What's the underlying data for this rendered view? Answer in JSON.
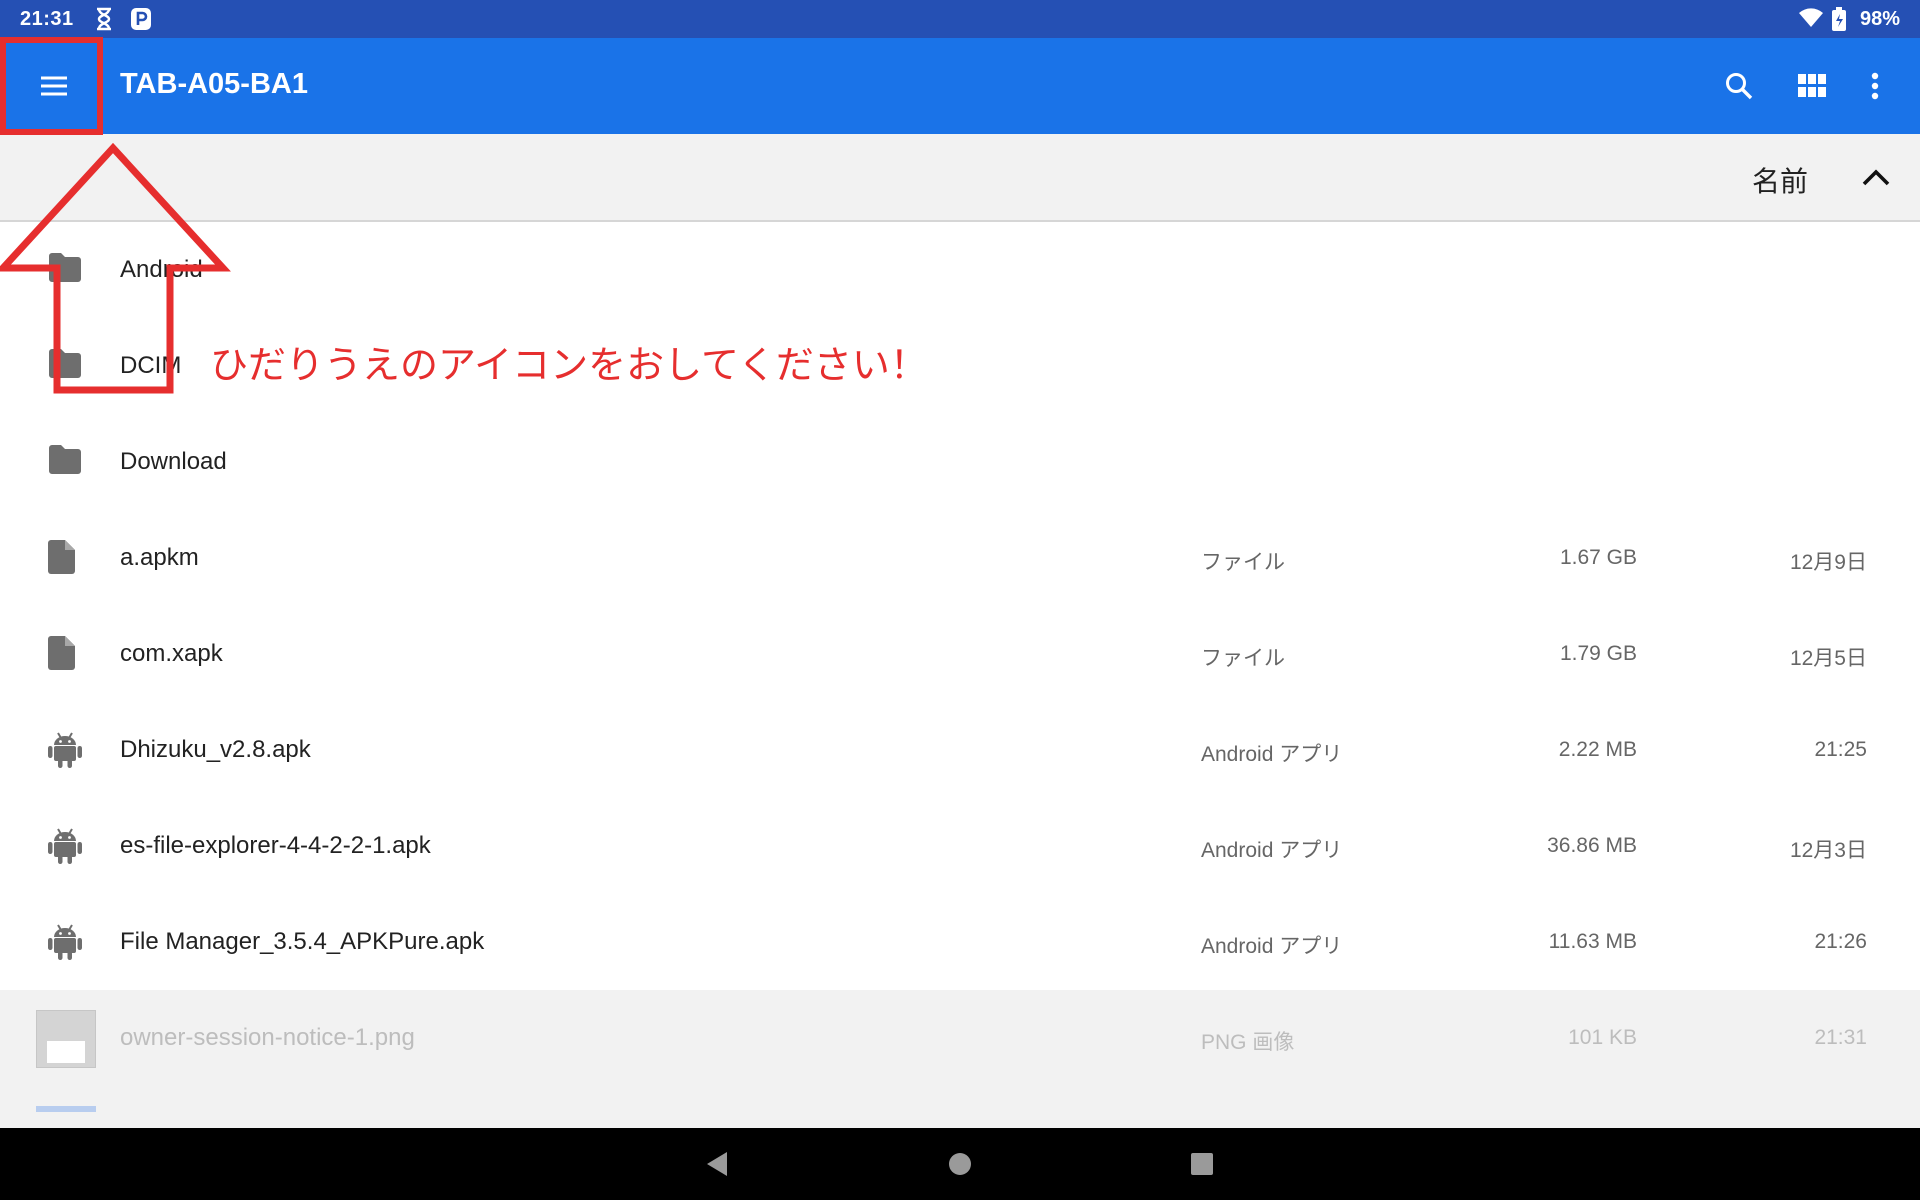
{
  "status_bar": {
    "time": "21:31",
    "battery": "98%",
    "icons": [
      "hourglass-icon",
      "p-app-icon",
      "wifi-icon",
      "battery-icon"
    ]
  },
  "toolbar": {
    "title": "TAB-A05-BA1",
    "menu_icon": "hamburger-menu-icon",
    "search_icon": "search-icon",
    "grid_icon": "grid-view-icon",
    "more_icon": "more-vert-icon"
  },
  "sort": {
    "label": "名前",
    "direction_icon": "chevron-up-icon"
  },
  "files": [
    {
      "name": "Android",
      "icon": "folder-icon",
      "type": "",
      "size": "",
      "date": ""
    },
    {
      "name": "DCIM",
      "icon": "folder-icon",
      "type": "",
      "size": "",
      "date": ""
    },
    {
      "name": "Download",
      "icon": "folder-icon",
      "type": "",
      "size": "",
      "date": ""
    },
    {
      "name": "a.apkm",
      "icon": "file-icon",
      "type": "ファイル",
      "size": "1.67 GB",
      "date": "12月9日"
    },
    {
      "name": "com.xapk",
      "icon": "file-icon",
      "type": "ファイル",
      "size": "1.79 GB",
      "date": "12月5日"
    },
    {
      "name": "Dhizuku_v2.8.apk",
      "icon": "android-icon",
      "type": "Android アプリ",
      "size": "2.22 MB",
      "date": "21:25"
    },
    {
      "name": "es-file-explorer-4-4-2-2-1.apk",
      "icon": "android-icon",
      "type": "Android アプリ",
      "size": "36.86 MB",
      "date": "12月3日"
    },
    {
      "name": "File Manager_3.5.4_APKPure.apk",
      "icon": "android-icon",
      "type": "Android アプリ",
      "size": "11.63 MB",
      "date": "21:26"
    },
    {
      "name": "owner-session-notice-1.png",
      "icon": "image-thumbnail",
      "type": "PNG 画像",
      "size": "101 KB",
      "date": "21:31"
    }
  ],
  "annotation": {
    "text": "ひだりうえのアイコンをおしてください！",
    "color": "#e62e2e"
  },
  "nav_bar": {
    "icons": [
      "back-icon",
      "home-icon",
      "recents-icon"
    ]
  },
  "colors": {
    "status_bar": "#2550b4",
    "toolbar": "#1a73e8",
    "annotation_red": "#e62e2e"
  }
}
